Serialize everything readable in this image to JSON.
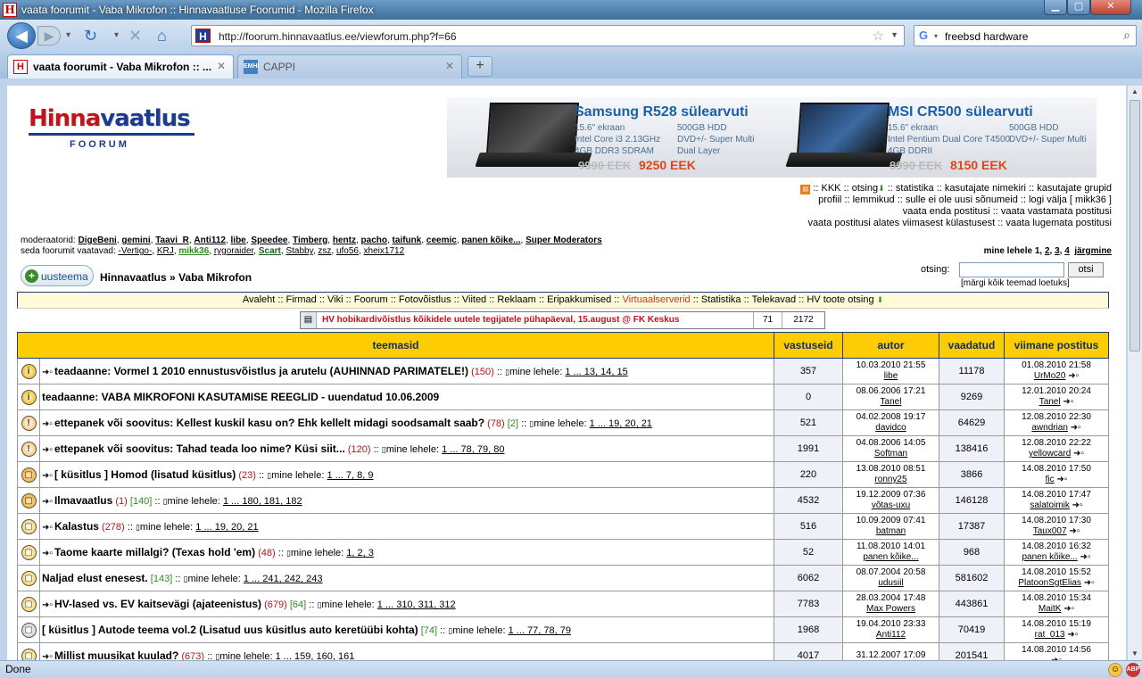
{
  "window": {
    "title": "vaata foorumit - Vaba Mikrofon :: Hinnavaatluse Foorumid - Mozilla Firefox",
    "min": "▁",
    "max": "▢",
    "close": "✕"
  },
  "nav": {
    "url": "http://foorum.hinnavaatlus.ee/viewforum.php?f=66",
    "search_value": "freebsd hardware"
  },
  "tabs": [
    {
      "label": "vaata foorumit - Vaba Mikrofon :: ..."
    },
    {
      "label": "CAPPI"
    }
  ],
  "status": {
    "text": "Done",
    "abp": "ABP"
  },
  "logo": {
    "part1": "Hinna",
    "part2": "vaatlus",
    "sub": "FOORUM"
  },
  "ads": [
    {
      "title": "Samsung R528 sülearvuti",
      "spec_left": [
        "15.6\" ekraan",
        "Intel Core i3 2.13GHz",
        "4GB DDR3 SDRAM"
      ],
      "spec_right": [
        "500GB HDD",
        "DVD+/- Super Multi",
        "Dual Layer"
      ],
      "old_price": "9990 EEK",
      "price": "9250 EEK"
    },
    {
      "title": "MSI CR500 sülearvuti",
      "spec_left": [
        "15.6\" ekraan",
        "Intel Pentium Dual Core T4500",
        "4GB DDRII"
      ],
      "spec_right": [
        "500GB HDD",
        "DVD+/- Super Multi",
        ""
      ],
      "old_price": "8990 EEK",
      "price": "8150 EEK"
    }
  ],
  "links": {
    "line1": ":: KKK :: otsing",
    "line1b": " :: statistika :: kasutajate nimekiri :: kasutajate grupid",
    "line2": "profiil :: lemmikud :: sulle ei ole uusi sõnumeid :: logi välja [ mikk36 ]",
    "line3": "vaata enda postitusi :: vaata vastamata postitusi",
    "line4": "vaata postitusi alates viimasest külastusest :: vaata lugemata postitusi"
  },
  "moderators": {
    "label": "moderaatorid:",
    "names": [
      "DigeBeni",
      "gemini",
      "Taavi_R",
      "Anti112",
      "libe",
      "Speedee",
      "Timberg",
      "hentz",
      "pacho",
      "taifunk",
      "ceemic",
      "panen kõike...",
      "Super Moderators"
    ]
  },
  "viewers": {
    "label": "seda foorumit vaatavad:",
    "names": [
      "-Vertigo-",
      "KRJ",
      "mikk36",
      "rygoraider",
      "Scart",
      "Stabby",
      "zsz",
      "ufo56",
      "xheix1712"
    ]
  },
  "pagination": {
    "label": "mine lehele",
    "current": "1",
    "pages": [
      "2",
      "3",
      "4"
    ],
    "next": "järgmine"
  },
  "newtopic": {
    "label": "uusteema"
  },
  "breadcrumb": {
    "home": "Hinnavaatlus",
    "sep": "»",
    "forum": "Vaba Mikrofon"
  },
  "search": {
    "label": "otsing:",
    "button": "otsi",
    "markread": "[märgi kõik teemad loetuks]"
  },
  "menu": [
    "Avaleht",
    "Firmad",
    "Viki",
    "Foorum",
    "Fotovõistlus",
    "Viited",
    "Reklaam",
    "Eripakkumised",
    "Virtuaalserverid",
    "Statistika",
    "Telekavad",
    "HV toote otsing"
  ],
  "announcement": {
    "text": "HV hobikardivõistlus kõikidele uutele tegijatele pühapäeval, 15.august @ FK Keskus",
    "replies": "71",
    "views": "2172"
  },
  "table": {
    "headers": {
      "topics": "teemasid",
      "replies": "vastuseid",
      "author": "autor",
      "views": "vaadatud",
      "last": "viimane postitus"
    }
  },
  "topics": [
    {
      "icon": "ic-info",
      "glyph": "i",
      "title": "teadaanne: Vormel 1 2010 ennustusvõistlus ja arutelu (AUHINNAD PARIMATELE!)",
      "red": "(150)",
      "green": "",
      "pages": "1 ... 13, 14, 15",
      "replies": "357",
      "date": "10.03.2010 21:55",
      "author": "libe",
      "views": "11178",
      "last_date": "01.08.2010 21:58",
      "last_user": "UrMo20",
      "new": true
    },
    {
      "icon": "ic-info",
      "glyph": "i",
      "title": "teadaanne: VABA MIKROFONI KASUTAMISE REEGLID - uuendatud 10.06.2009",
      "red": "",
      "green": "",
      "pages": "",
      "replies": "0",
      "date": "08.06.2006 17:21",
      "author": "Tanel",
      "views": "9269",
      "last_date": "12.01.2010 20:24",
      "last_user": "Tanel",
      "new": false
    },
    {
      "icon": "ic-warn",
      "glyph": "!",
      "title": "ettepanek või soovitus: Kellest kuskil kasu on? Ehk kellelt midagi soodsamalt saab?",
      "red": "(78)",
      "green": "[2]",
      "pages": "1 ... 19, 20, 21",
      "replies": "521",
      "date": "04.02.2008 19:17",
      "author": "davidco",
      "views": "64629",
      "last_date": "12.08.2010 22:30",
      "last_user": "awndrian",
      "new": true
    },
    {
      "icon": "ic-warn",
      "glyph": "!",
      "title": "ettepanek või soovitus: Tahad teada loo nime? Küsi siit...",
      "red": "(120)",
      "green": "",
      "pages": "1 ... 78, 79, 80",
      "replies": "1991",
      "date": "04.08.2006 14:05",
      "author": "Softman",
      "views": "138416",
      "last_date": "12.08.2010 22:22",
      "last_user": "yellowcard",
      "new": true
    },
    {
      "icon": "ic-hot",
      "glyph": "▢",
      "title": "[ küsitlus ] Homod (lisatud küsitlus)",
      "red": "(23)",
      "green": "",
      "pages": "1 ... 7, 8, 9",
      "replies": "220",
      "date": "13.08.2010 08:51",
      "author": "ronny25",
      "views": "3866",
      "last_date": "14.08.2010 17:50",
      "last_user": "fic",
      "new": true
    },
    {
      "icon": "ic-hot",
      "glyph": "▢",
      "title": "Ilmavaatlus",
      "red": "(1)",
      "green": "[140]",
      "pages": "1 ... 180, 181, 182",
      "replies": "4532",
      "date": "19.12.2009 07:36",
      "author": "võtas-uxu",
      "views": "146128",
      "last_date": "14.08.2010 17:47",
      "last_user": "salatoimik",
      "new": true
    },
    {
      "icon": "ic-norm",
      "glyph": "▢",
      "title": "Kalastus",
      "red": "(278)",
      "green": "",
      "pages": "1 ... 19, 20, 21",
      "replies": "516",
      "date": "10.09.2009 07:41",
      "author": "batman",
      "views": "17387",
      "last_date": "14.08.2010 17:30",
      "last_user": "Taux007",
      "new": true
    },
    {
      "icon": "ic-norm",
      "glyph": "▢",
      "title": "Taome kaarte millalgi? (Texas hold 'em)",
      "red": "(48)",
      "green": "",
      "pages": "1, 2, 3",
      "replies": "52",
      "date": "11.08.2010 14:01",
      "author": "panen kõike...",
      "views": "968",
      "last_date": "14.08.2010 16:32",
      "last_user": "panen kõike...",
      "new": true
    },
    {
      "icon": "ic-norm",
      "glyph": "▢",
      "title": "Naljad elust enesest.",
      "red": "",
      "green": "[143]",
      "pages": "1 ... 241, 242, 243",
      "replies": "6062",
      "date": "08.07.2004 20:58",
      "author": "udusiil",
      "views": "581602",
      "last_date": "14.08.2010 15:52",
      "last_user": "PlatoonSgtElias",
      "new": false
    },
    {
      "icon": "ic-norm",
      "glyph": "▢",
      "title": "HV-lased vs. EV kaitsevägi (ajateenistus)",
      "red": "(679)",
      "green": "[64]",
      "pages": "1 ... 310, 311, 312",
      "replies": "7783",
      "date": "28.03.2004 17:48",
      "author": "Max Powers",
      "views": "443861",
      "last_date": "14.08.2010 15:34",
      "last_user": "MaitK",
      "new": true
    },
    {
      "icon": "ic-grey",
      "glyph": "▢",
      "title": "[ küsitlus ] Autode teema vol.2 (Lisatud uus küsitlus auto keretüübi kohta)",
      "red": "",
      "green": "[74]",
      "pages": "1 ... 77, 78, 79",
      "replies": "1968",
      "date": "19.04.2010 23:33",
      "author": "Anti112",
      "views": "70419",
      "last_date": "14.08.2010 15:19",
      "last_user": "rat_013",
      "new": false
    },
    {
      "icon": "ic-norm",
      "glyph": "▢",
      "title": "Millist muusikat kuulad?",
      "red": "(673)",
      "green": "",
      "pages": "1 ... 159, 160, 161",
      "replies": "4017",
      "date": "31.12.2007 17:09",
      "author": "",
      "views": "201541",
      "last_date": "14.08.2010 14:56",
      "last_user": "",
      "new": true
    }
  ],
  "pages_label": "mine lehele:"
}
